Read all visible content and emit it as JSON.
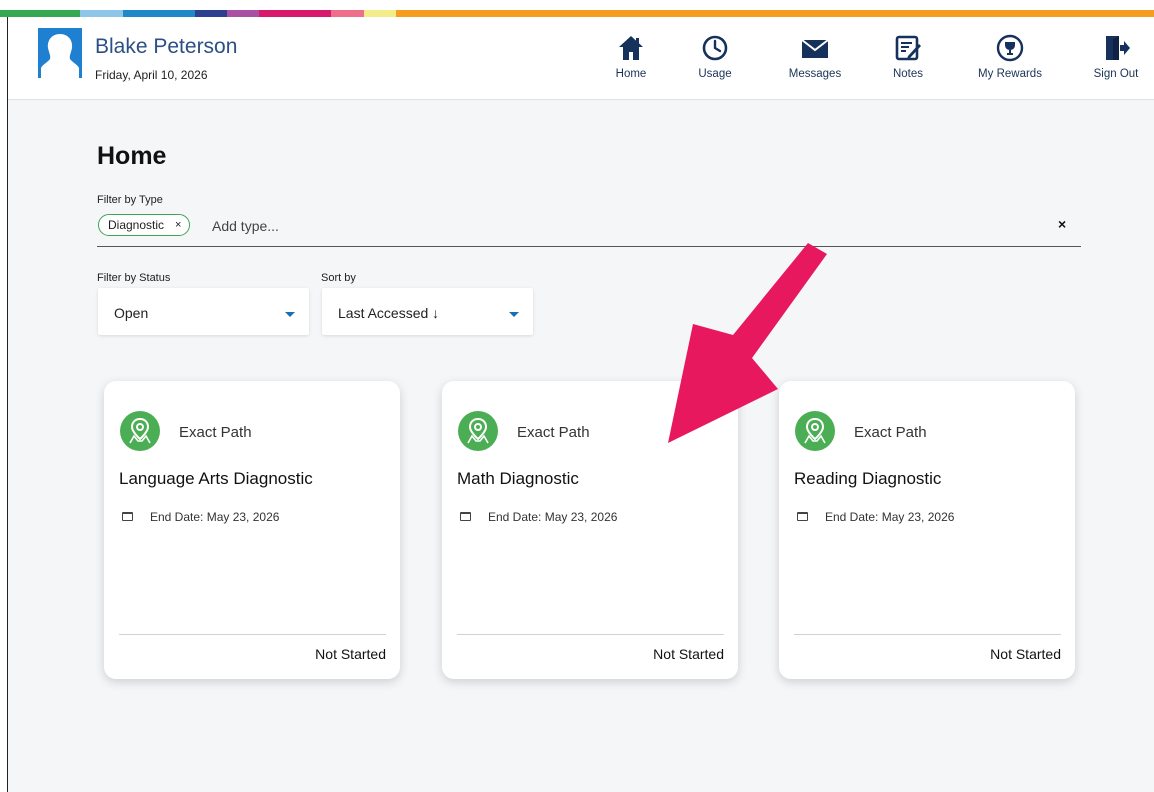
{
  "user": {
    "name": "Blake Peterson",
    "date": "Friday, April 10, 2026"
  },
  "nav": [
    {
      "label": "Home",
      "icon": "home-icon"
    },
    {
      "label": "Usage",
      "icon": "clock-icon"
    },
    {
      "label": "Messages",
      "icon": "envelope-icon"
    },
    {
      "label": "Notes",
      "icon": "notes-icon"
    },
    {
      "label": "My Rewards",
      "icon": "trophy-icon"
    },
    {
      "label": "Sign Out",
      "icon": "sign-out-icon"
    }
  ],
  "page": {
    "title": "Home"
  },
  "filter_type": {
    "label": "Filter by Type",
    "chip": "Diagnostic",
    "chip_remove": "×",
    "placeholder": "Add type...",
    "clear": "×"
  },
  "filter_status": {
    "label": "Filter by Status",
    "value": "Open"
  },
  "sort": {
    "label": "Sort by",
    "value": "Last Accessed ↓"
  },
  "cards": [
    {
      "brand": "Exact Path",
      "title": "Language Arts Diagnostic",
      "end_date": "End Date: May 23, 2026",
      "status": "Not Started"
    },
    {
      "brand": "Exact Path",
      "title": "Math Diagnostic",
      "end_date": "End Date: May 23, 2026",
      "status": "Not Started"
    },
    {
      "brand": "Exact Path",
      "title": "Reading Diagnostic",
      "end_date": "End Date: May 23, 2026",
      "status": "Not Started"
    }
  ],
  "colors": {
    "accent_green": "#4cae54",
    "nav_navy": "#16325c",
    "name_blue": "#2b4f86",
    "annotation_arrow": "#e8185f",
    "stripes": [
      "#35a852",
      "#8ec6e8",
      "#1f88c9",
      "#2f3f8f",
      "#a950a3",
      "#d8186c",
      "#ef6e8c",
      "#f3ec8a",
      "#f59d1f"
    ]
  }
}
